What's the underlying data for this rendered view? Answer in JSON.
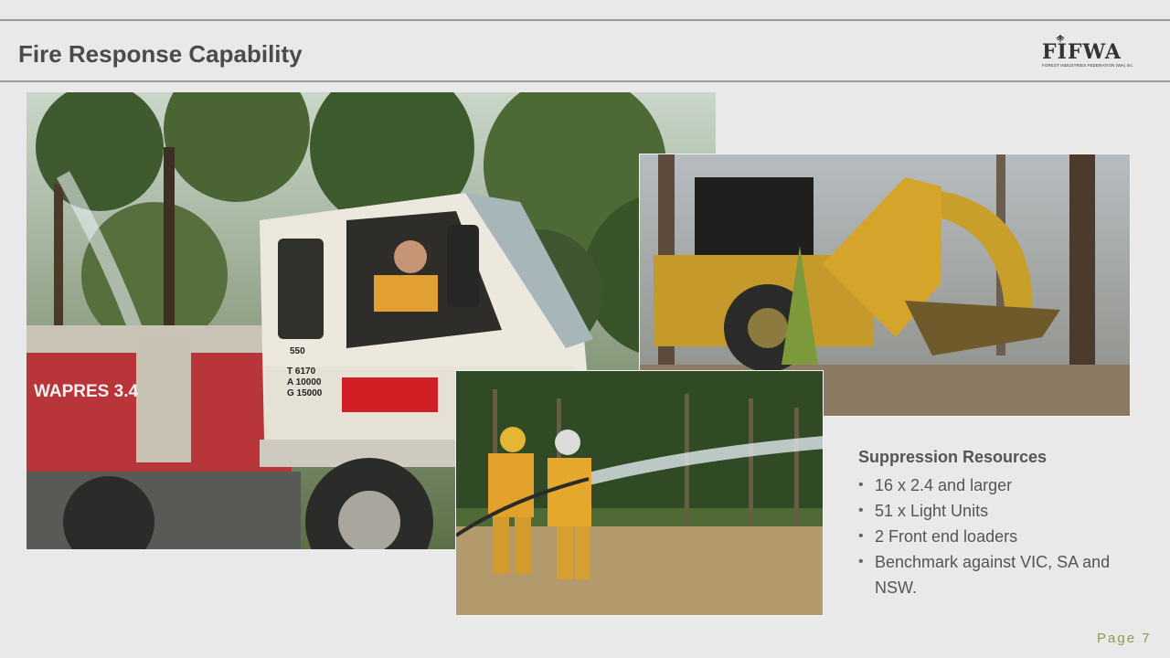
{
  "slide": {
    "title": "Fire Response Capability",
    "page": "Page 7"
  },
  "logo": {
    "name": "FIFWA",
    "subtitle": "FOREST INDUSTRIES FEDERATION (WA) Inc."
  },
  "photos": {
    "truck": {
      "tank_label": "WAPRES 3.4",
      "cab_code": "550",
      "cab_lines": [
        "T 6170",
        "A 10000",
        "G 15000"
      ]
    },
    "loader": {},
    "hose": {}
  },
  "resources": {
    "heading": "Suppression Resources",
    "items": [
      "16 x 2.4 and larger",
      "51 x Light Units",
      "2 Front end loaders",
      "Benchmark against VIC, SA and NSW."
    ]
  },
  "colors": {
    "title": "#4b4b4b",
    "accent": "#8aa04e",
    "text": "#555555"
  }
}
